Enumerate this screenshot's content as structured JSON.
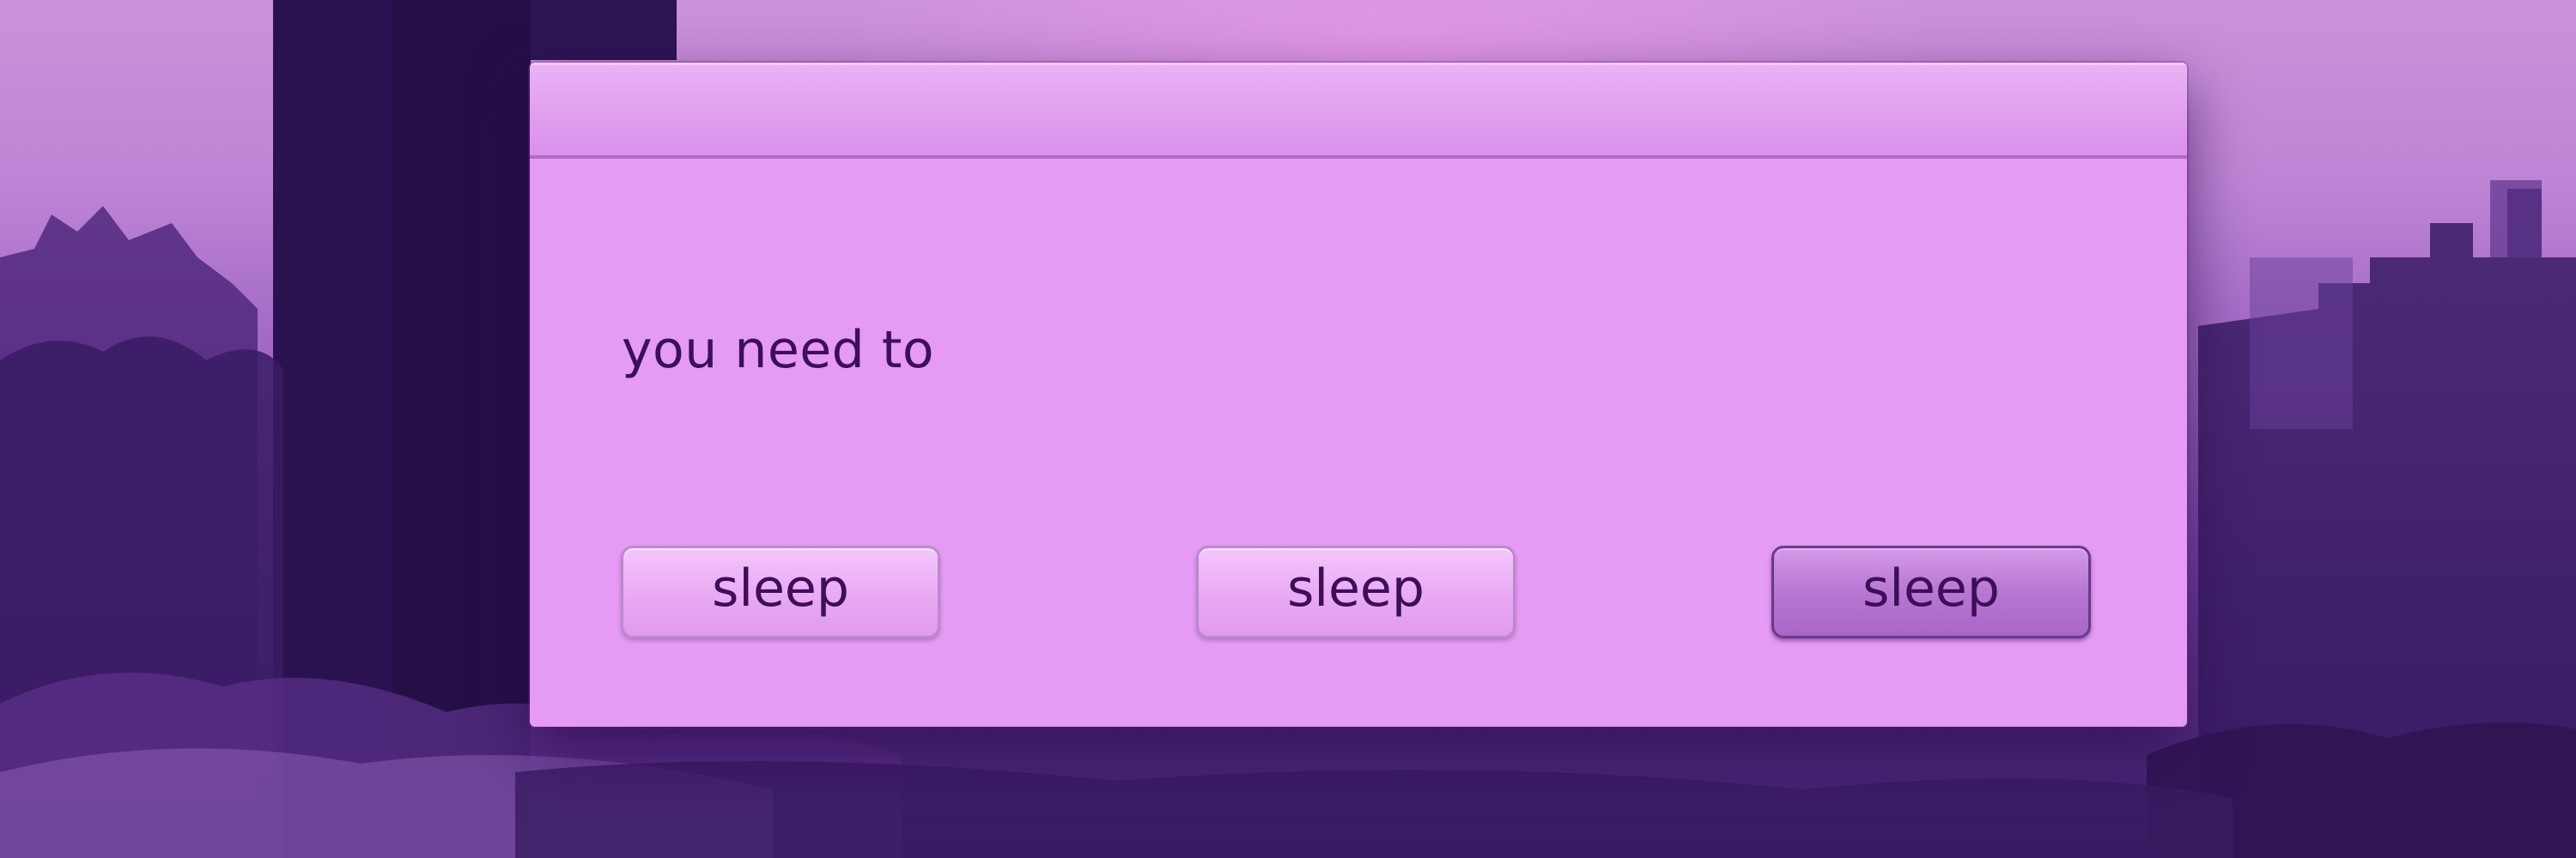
{
  "dialog": {
    "title": "",
    "message": "you need to",
    "buttons": [
      {
        "label": "sleep",
        "default": false
      },
      {
        "label": "sleep",
        "default": false
      },
      {
        "label": "sleep",
        "default": true
      }
    ]
  },
  "theme": {
    "accent": "#e59af3",
    "background": "#a36fc4",
    "text": "#3c0f58"
  }
}
